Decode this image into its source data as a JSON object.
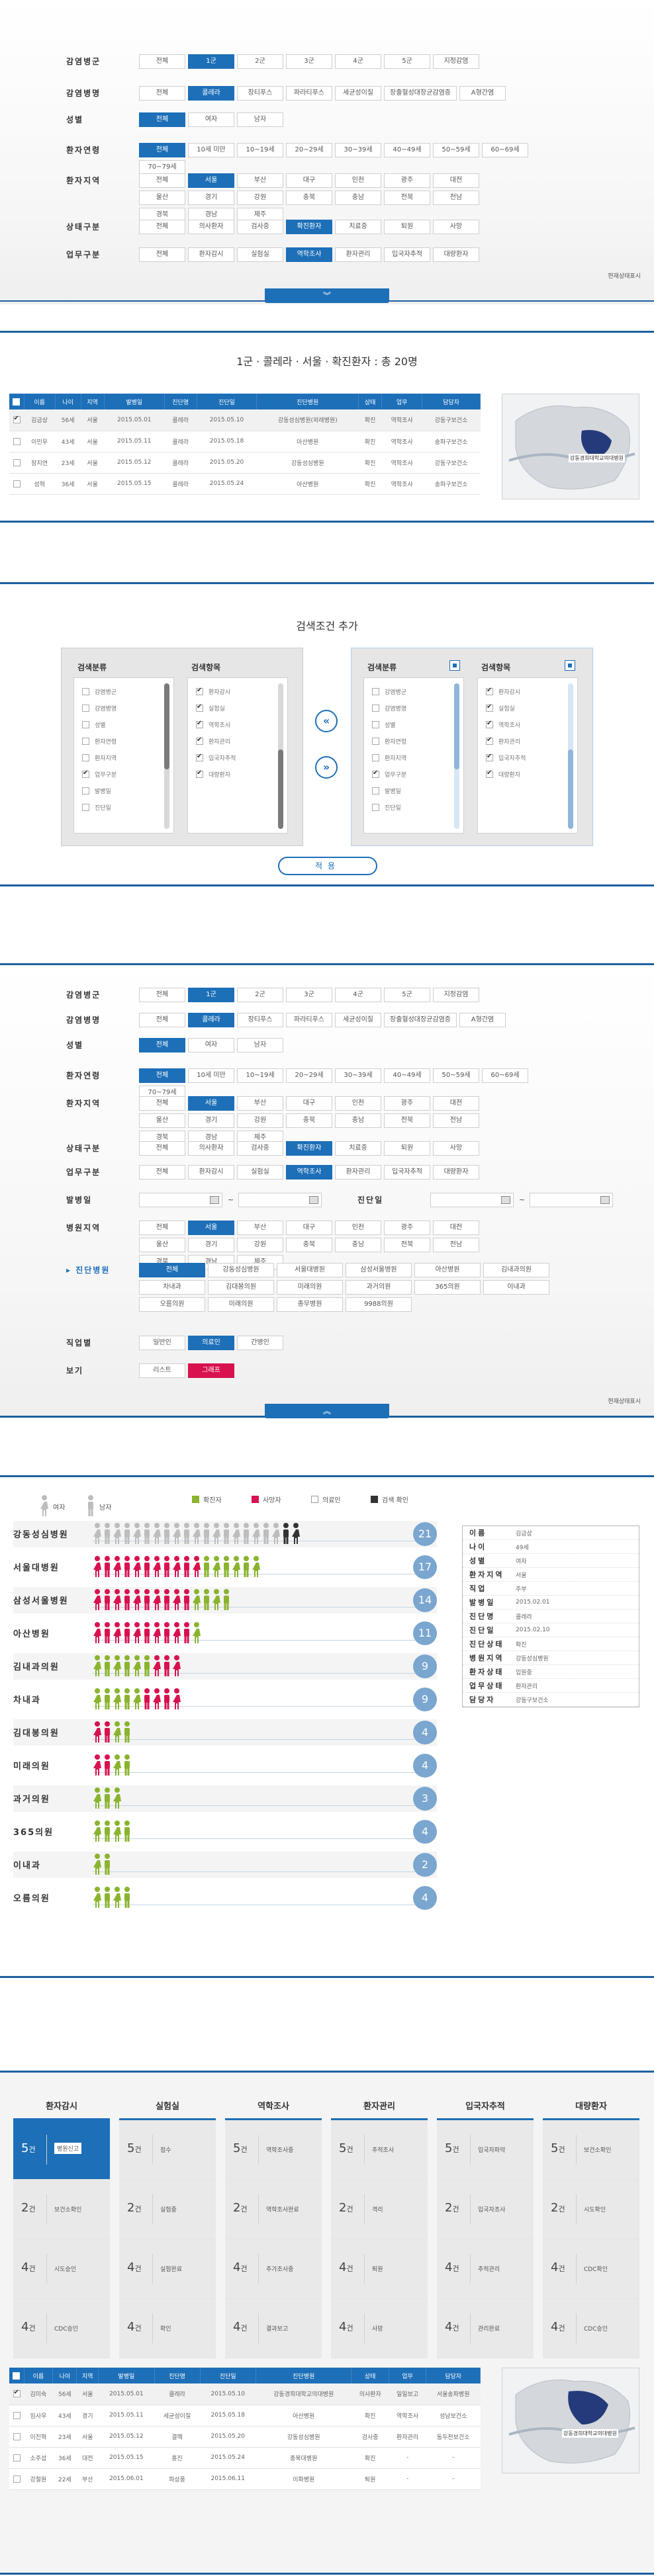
{
  "filter_common": {
    "infection_group": {
      "label": "감염병군",
      "options": [
        "전체",
        "1군",
        "2군",
        "3군",
        "4군",
        "5군",
        "지정감염"
      ],
      "selected": "1군"
    },
    "infection_disease": {
      "label": "감염병명",
      "options": [
        "전체",
        "콜레라",
        "장티푸스",
        "파라티푸스",
        "세균성이질",
        "장출혈성대장균감염증",
        "A형간염"
      ],
      "selected": "콜레라"
    },
    "gender": {
      "label": "성별",
      "options": [
        "전체",
        "여자",
        "남자"
      ],
      "selected": "전체"
    },
    "age": {
      "label": "환자연령",
      "options": [
        "전체",
        "10세 미만",
        "10~19세",
        "20~29세",
        "30~39세",
        "40~49세",
        "50~59세",
        "60~69세",
        "70~79세"
      ],
      "selected": "전체"
    },
    "region": {
      "label": "환자지역",
      "options": [
        "전체",
        "서울",
        "부산",
        "대구",
        "인천",
        "광주",
        "대전",
        "울산",
        "경기",
        "강원",
        "충북",
        "충남",
        "전북",
        "전남",
        "경북",
        "경남",
        "제주"
      ],
      "selected": "서울"
    },
    "status": {
      "label": "상태구분",
      "options": [
        "전체",
        "의사환자",
        "검사중",
        "확진환자",
        "치료중",
        "퇴원",
        "사망"
      ],
      "selected": "확진환자"
    },
    "work": {
      "label": "업무구분",
      "options": [
        "전체",
        "환자감시",
        "실험실",
        "역학조사",
        "환자관리",
        "입국자추적",
        "대량환자"
      ],
      "selected": "역학조사"
    }
  },
  "section1": {
    "current_status": "현재상태표시",
    "toggle_icon": "chevron-down-icon"
  },
  "section2": {
    "title": "1군 · 콜레라 · 서울 · 확진환자 : 총 20명",
    "columns": [
      "이름",
      "나이",
      "지역",
      "발병일",
      "진단명",
      "진단일",
      "진단병원",
      "상태",
      "업무",
      "담당자"
    ],
    "rows": [
      {
        "checked": true,
        "cells": [
          "김금상",
          "56세",
          "서울",
          "2015.05.01",
          "콜레라",
          "2015.05.10",
          "강동성심병원(외래병원)",
          "확진",
          "역학조사",
          "강동구보건소"
        ]
      },
      {
        "checked": false,
        "cells": [
          "이민우",
          "43세",
          "서울",
          "2015.05.11",
          "콜레라",
          "2015.05.18",
          "아산병원",
          "확진",
          "역학조사",
          "송파구보건소"
        ]
      },
      {
        "checked": false,
        "cells": [
          "장지연",
          "23세",
          "서울",
          "2015.05.12",
          "콜레라",
          "2015.05.20",
          "강동성심병원",
          "확진",
          "역학조사",
          "강동구보건소"
        ]
      },
      {
        "checked": false,
        "cells": [
          "성혁",
          "36세",
          "서울",
          "2015.05.15",
          "콜레라",
          "2015.05.24",
          "아산병원",
          "확진",
          "역학조사",
          "송파구보건소"
        ]
      }
    ],
    "map_label": "강동경희대학교의대병원"
  },
  "section3": {
    "title": "검색조건 추가",
    "left_panel": {
      "col1_title": "검색분류",
      "col2_title": "검색항목",
      "col1_items": [
        {
          "label": "감염병군",
          "checked": false
        },
        {
          "label": "감염병명",
          "checked": false
        },
        {
          "label": "성별",
          "checked": false
        },
        {
          "label": "환자연령",
          "checked": false
        },
        {
          "label": "환자지역",
          "checked": false
        },
        {
          "label": "업무구분",
          "checked": true
        },
        {
          "label": "발병일",
          "checked": false
        },
        {
          "label": "진단일",
          "checked": false
        }
      ],
      "col2_items": [
        {
          "label": "환자감시",
          "checked": true
        },
        {
          "label": "실험실",
          "checked": true
        },
        {
          "label": "역학조사",
          "checked": true
        },
        {
          "label": "환자관리",
          "checked": true
        },
        {
          "label": "입국자추적",
          "checked": true
        },
        {
          "label": "대량환자",
          "checked": true
        }
      ]
    },
    "right_panel": {
      "col1_title": "검색분류",
      "col2_title": "검색항목",
      "col1_items": [
        {
          "label": "감염병군",
          "checked": false
        },
        {
          "label": "감염병명",
          "checked": false
        },
        {
          "label": "성별",
          "checked": false
        },
        {
          "label": "환자연령",
          "checked": false
        },
        {
          "label": "환자지역",
          "checked": false
        },
        {
          "label": "업무구분",
          "checked": true
        },
        {
          "label": "발병일",
          "checked": false
        },
        {
          "label": "진단일",
          "checked": false
        }
      ],
      "col2_items": [
        {
          "label": "환자감시",
          "checked": true
        },
        {
          "label": "실험실",
          "checked": true
        },
        {
          "label": "역학조사",
          "checked": true
        },
        {
          "label": "환자관리",
          "checked": true
        },
        {
          "label": "입국자추적",
          "checked": true
        },
        {
          "label": "대량환자",
          "checked": true
        }
      ]
    },
    "left_arrow": "«",
    "right_arrow": "»",
    "apply_label": "적용"
  },
  "section4": {
    "onset_label": "발병일",
    "diag_label": "진단일",
    "tilde": "~",
    "hospital_region": {
      "label": "병원지역",
      "options": [
        "전체",
        "서울",
        "부산",
        "대구",
        "인천",
        "광주",
        "대전",
        "울산",
        "경기",
        "강원",
        "충북",
        "충남",
        "전북",
        "전남",
        "경북",
        "경남",
        "제주"
      ],
      "selected": "서울"
    },
    "hospital": {
      "label": "진단병원",
      "prefix": "▸",
      "options": [
        "전체",
        "강동성심병원",
        "서울대병원",
        "삼성서울병원",
        "아산병원",
        "김내과의원",
        "차내과",
        "김대봉의원",
        "미래의원",
        "과거의원",
        "365의원",
        "이내과",
        "오름의원",
        "미래의원",
        "종무병원",
        "9988의원"
      ],
      "selected": "전체"
    },
    "job": {
      "label": "직업별",
      "options": [
        "일반인",
        "의료인",
        "간병인"
      ],
      "selected": "의료인"
    },
    "view": {
      "label": "보기",
      "options": [
        "리스트",
        "그래프"
      ],
      "selected": "그래프"
    },
    "current_status": "현재상태표시",
    "toggle_icon": "chevron-up-icon"
  },
  "section5": {
    "legend": {
      "female": "여자",
      "male": "남자",
      "confirmed": "확진자",
      "death": "사망자",
      "suspect": "의료인",
      "checked": "검색 확인"
    },
    "colors": {
      "green": "#8ab42e",
      "red": "#d8124f",
      "gray": "#bdbdbd",
      "black": "#333333",
      "badge": "#7aa6cf"
    },
    "hospitals": [
      {
        "name": "강동성심병원",
        "count": "21",
        "figs": "gggggggggggggggggggkk"
      },
      {
        "name": "서울대병원",
        "count": "17",
        "figs": "rrrrrrrrrrrgggggg"
      },
      {
        "name": "삼성서울병원",
        "count": "14",
        "figs": "rrrrrrrrrrgggg"
      },
      {
        "name": "아산병원",
        "count": "11",
        "figs": "rrrrrrrrrrg"
      },
      {
        "name": "김내과의원",
        "count": "9",
        "figs": "ggggggrrr"
      },
      {
        "name": "차내과",
        "count": "9",
        "figs": "gggggrrrr"
      },
      {
        "name": "김대봉의원",
        "count": "4",
        "figs": "rrgg"
      },
      {
        "name": "미래의원",
        "count": "4",
        "figs": "rrgg"
      },
      {
        "name": "과거의원",
        "count": "3",
        "figs": "ggg"
      },
      {
        "name": "365의원",
        "count": "4",
        "figs": "gggg"
      },
      {
        "name": "이내과",
        "count": "2",
        "figs": "gg"
      },
      {
        "name": "오름의원",
        "count": "4",
        "figs": "gggg"
      }
    ],
    "info": [
      {
        "k": "이름",
        "v": "김금상"
      },
      {
        "k": "나이",
        "v": "49세"
      },
      {
        "k": "성별",
        "v": "여자"
      },
      {
        "k": "환자지역",
        "v": "서울"
      },
      {
        "k": "직업",
        "v": "주부"
      },
      {
        "k": "발병일",
        "v": "2015.02.01"
      },
      {
        "k": "진단명",
        "v": "콜레라"
      },
      {
        "k": "진단일",
        "v": "2015.02.10"
      },
      {
        "k": "진단상태",
        "v": "확진"
      },
      {
        "k": "병원지역",
        "v": "강동성심병원"
      },
      {
        "k": "환자상태",
        "v": "입원중"
      },
      {
        "k": "업무상태",
        "v": "환자관리"
      },
      {
        "k": "담당자",
        "v": "강동구보건소"
      }
    ]
  },
  "section6": {
    "columns": [
      {
        "title": "환자감시",
        "cards": [
          {
            "n": "5",
            "u": "건",
            "l": "병원신고"
          },
          {
            "n": "2",
            "u": "건",
            "l": "보건소확인"
          },
          {
            "n": "4",
            "u": "건",
            "l": "시도승인"
          },
          {
            "n": "4",
            "u": "건",
            "l": "CDC승인"
          }
        ]
      },
      {
        "title": "실험실",
        "cards": [
          {
            "n": "5",
            "u": "건",
            "l": "접수"
          },
          {
            "n": "2",
            "u": "건",
            "l": "실험중"
          },
          {
            "n": "4",
            "u": "건",
            "l": "실험완료"
          },
          {
            "n": "4",
            "u": "건",
            "l": "확인"
          }
        ]
      },
      {
        "title": "역학조사",
        "cards": [
          {
            "n": "5",
            "u": "건",
            "l": "역학조사중"
          },
          {
            "n": "2",
            "u": "건",
            "l": "역학조사완료"
          },
          {
            "n": "4",
            "u": "건",
            "l": "추가조사중"
          },
          {
            "n": "4",
            "u": "건",
            "l": "결과보고"
          }
        ]
      },
      {
        "title": "환자관리",
        "cards": [
          {
            "n": "5",
            "u": "건",
            "l": "추적조사"
          },
          {
            "n": "2",
            "u": "건",
            "l": "격리"
          },
          {
            "n": "4",
            "u": "건",
            "l": "퇴원"
          },
          {
            "n": "4",
            "u": "건",
            "l": "사망"
          }
        ]
      },
      {
        "title": "입국자추적",
        "cards": [
          {
            "n": "5",
            "u": "건",
            "l": "입국자파악"
          },
          {
            "n": "2",
            "u": "건",
            "l": "입국자조사"
          },
          {
            "n": "4",
            "u": "건",
            "l": "추적관리"
          },
          {
            "n": "4",
            "u": "건",
            "l": "관리완료"
          }
        ]
      },
      {
        "title": "대량환자",
        "cards": [
          {
            "n": "5",
            "u": "건",
            "l": "보건소확인"
          },
          {
            "n": "2",
            "u": "건",
            "l": "시도확인"
          },
          {
            "n": "4",
            "u": "건",
            "l": "CDC확인"
          },
          {
            "n": "4",
            "u": "건",
            "l": "CDC승인"
          }
        ]
      }
    ],
    "table_columns": [
      "이름",
      "나이",
      "지역",
      "발병일",
      "진단명",
      "진단일",
      "진단병원",
      "상태",
      "업무",
      "담당자"
    ],
    "rows": [
      {
        "checked": true,
        "cells": [
          "김미숙",
          "56세",
          "서울",
          "2015.05.01",
          "콜레라",
          "2015.05.10",
          "강동경희대학교의대병원",
          "의사환자",
          "일일보고",
          "서울송파병원"
        ]
      },
      {
        "checked": false,
        "cells": [
          "임사우",
          "43세",
          "경기",
          "2015.05.11",
          "세균성이질",
          "2015.05.18",
          "아산병원",
          "확진",
          "역학조사",
          "성남보건소"
        ]
      },
      {
        "checked": false,
        "cells": [
          "이진혁",
          "23세",
          "서울",
          "2015.05.12",
          "결핵",
          "2015.05.20",
          "강동성심병원",
          "검사중",
          "환자관리",
          "동두천보건소"
        ]
      },
      {
        "checked": false,
        "cells": [
          "소주섭",
          "36세",
          "대전",
          "2015.05.15",
          "홍진",
          "2015.05.24",
          "충북대병원",
          "확진",
          "-",
          "-"
        ]
      },
      {
        "checked": false,
        "cells": [
          "강철원",
          "22세",
          "부산",
          "2015.06.01",
          "파상풍",
          "2015.06.11",
          "이화병원",
          "퇴원",
          "-",
          "-"
        ]
      }
    ],
    "map_label": "강동경희대학교의대병원"
  }
}
